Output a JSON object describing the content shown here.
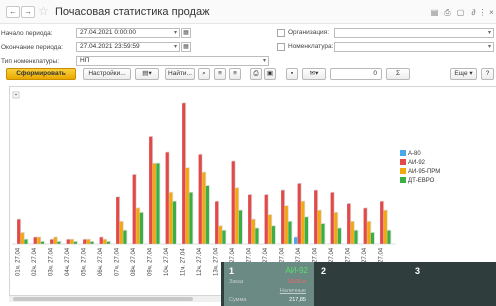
{
  "title": "Почасовая статистика продаж",
  "form": {
    "start_label": "Начало периода:",
    "start_value": "27.04.2021  0:00:00",
    "end_label": "Окончание периода:",
    "end_value": "27.04.2021 23:59:59",
    "nomen_type_label": "Тип номенклатуры:",
    "nomen_type_value": "НП",
    "org_label": "Организация:",
    "org_value": "",
    "nomenclature_label": "Номенклатура:",
    "nomenclature_value": ""
  },
  "toolbar": {
    "generate": "Сформировать",
    "settings": "Настройки...",
    "find": "Найти...",
    "number_value": "0",
    "sigma": "Σ",
    "more": "Еще",
    "help": "?"
  },
  "chart_data": {
    "type": "bar",
    "categories": [
      "01ч. 27.04",
      "02ч. 27.04",
      "03ч. 27.04",
      "04ч. 27.04",
      "05ч. 27.04",
      "06ч. 27.04",
      "07ч. 27.04",
      "08ч. 27.04",
      "09ч. 27.04",
      "10ч. 27.04",
      "11ч. 27.04",
      "12ч. 27.04",
      "13ч. 27.04",
      "14ч. 27.04",
      "15ч. 27.04",
      "16ч. 27.04",
      "17ч. 27.04",
      "18ч. 27.04",
      "19ч. 27.04",
      "20ч. 27.04",
      "21ч. 27.04",
      "22ч. 27.04",
      "23ч. 27.04"
    ],
    "series": [
      {
        "name": "А-80",
        "color": "#4aa8e8",
        "values": [
          0,
          0,
          0,
          0,
          0,
          0,
          0,
          0,
          0,
          0,
          0,
          0,
          0,
          0,
          0,
          0,
          0,
          0.3,
          0,
          0,
          0,
          0,
          0
        ]
      },
      {
        "name": "АИ-92",
        "color": "#e24a4a",
        "values": [
          1.1,
          0.3,
          0.2,
          0.2,
          0.2,
          0.3,
          2.1,
          3.1,
          4.8,
          4.1,
          6.3,
          4.0,
          1.9,
          3.7,
          2.2,
          2.2,
          2.4,
          2.7,
          2.4,
          2.3,
          1.8,
          1.6,
          1.9
        ]
      },
      {
        "name": "АИ-95-ПРМ",
        "color": "#f2a80f",
        "values": [
          0.5,
          0.3,
          0.3,
          0.2,
          0.2,
          0.2,
          1.0,
          1.6,
          3.6,
          2.3,
          3.4,
          3.2,
          0.8,
          2.5,
          1.1,
          1.3,
          1.7,
          1.9,
          1.5,
          1.4,
          1.0,
          1.0,
          1.5
        ]
      },
      {
        "name": "ДТ-ЕВРО",
        "color": "#3ab044",
        "values": [
          0.2,
          0.1,
          0.1,
          0.1,
          0.1,
          0.1,
          0.6,
          1.4,
          3.6,
          1.9,
          2.3,
          2.6,
          0.6,
          1.5,
          0.7,
          0.8,
          1.0,
          1.2,
          0.9,
          0.7,
          0.6,
          0.5,
          0.6
        ]
      }
    ],
    "ylim": [
      0,
      6.8
    ],
    "grid": false,
    "legend_position": "right"
  },
  "panel": {
    "tiles": [
      {
        "number": "1",
        "fuel": "АИ-92",
        "rows": [
          {
            "label": "Заказ",
            "value": "10,00 л",
            "value_color": "#ff6262"
          },
          {
            "label": "",
            "value": "Наличные",
            "value_color": "#c5cece"
          },
          {
            "label": "Сумма",
            "value": "217,85",
            "value_color": "#ffffff"
          }
        ]
      },
      {
        "number": "2"
      },
      {
        "number": "3"
      }
    ]
  }
}
